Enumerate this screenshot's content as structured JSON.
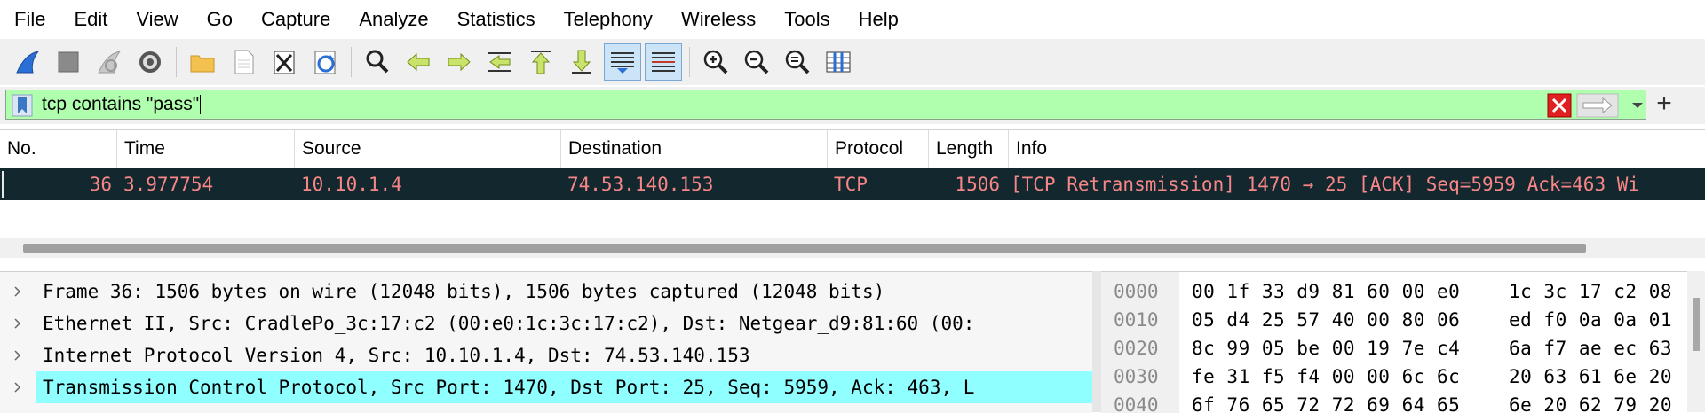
{
  "menu": [
    "File",
    "Edit",
    "View",
    "Go",
    "Capture",
    "Analyze",
    "Statistics",
    "Telephony",
    "Wireless",
    "Tools",
    "Help"
  ],
  "toolbar": {
    "icons": [
      "start-capture-icon",
      "stop-capture-icon",
      "restart-capture-icon",
      "capture-options-icon",
      "open-file-icon",
      "save-file-icon",
      "close-file-icon",
      "reload-file-icon",
      "find-packet-icon",
      "go-back-icon",
      "go-forward-icon",
      "go-to-packet-icon",
      "go-first-icon",
      "go-last-icon",
      "auto-scroll-icon",
      "colorize-icon",
      "zoom-in-icon",
      "zoom-out-icon",
      "normal-size-icon",
      "resize-columns-icon"
    ]
  },
  "filter": {
    "value": "tcp contains \"pass\"",
    "background": "#afffaf"
  },
  "columns": [
    "No.",
    "Time",
    "Source",
    "Destination",
    "Protocol",
    "Length",
    "Info"
  ],
  "packets": [
    {
      "no": "36",
      "time": "3.977754",
      "source": "10.10.1.4",
      "destination": "74.53.140.153",
      "protocol": "TCP",
      "length": "1506",
      "info": "[TCP Retransmission] 1470 → 25 [ACK] Seq=5959 Ack=463 Wi"
    }
  ],
  "details": [
    "Frame 36: 1506 bytes on wire (12048 bits), 1506 bytes captured (12048 bits)",
    "Ethernet II, Src: CradlePo_3c:17:c2 (00:e0:1c:3c:17:c2), Dst: Netgear_d9:81:60 (00:",
    "Internet Protocol Version 4, Src: 10.10.1.4, Dst: 74.53.140.153",
    "Transmission Control Protocol, Src Port: 1470, Dst Port: 25, Seq: 5959, Ack: 463, L"
  ],
  "hex": [
    {
      "offset": "0000",
      "b1": "00 1f 33 d9 81 60 00 e0",
      "b2": "1c 3c 17 c2 08"
    },
    {
      "offset": "0010",
      "b1": "05 d4 25 57 40 00 80 06",
      "b2": "ed f0 0a 0a 01"
    },
    {
      "offset": "0020",
      "b1": "8c 99 05 be 00 19 7e c4",
      "b2": "6a f7 ae ec 63"
    },
    {
      "offset": "0030",
      "b1": "fe 31 f5 f4 00 00 6c 6c",
      "b2": "20 63 61 6e 20"
    },
    {
      "offset": "0040",
      "b1": "6f 76 65 72 72 69 64 65",
      "b2": "6e 20 62 79 20"
    }
  ],
  "colors": {
    "selected_row_bg": "#12272e",
    "selected_row_fg": "#f78787",
    "detail_highlight": "#90ffff"
  }
}
